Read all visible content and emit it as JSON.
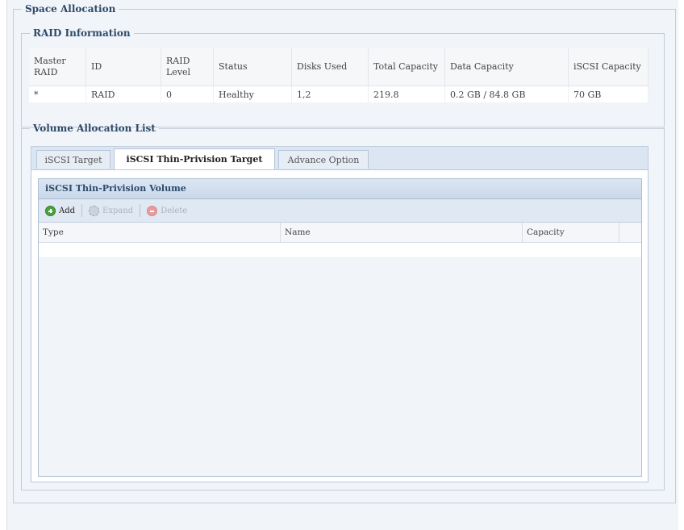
{
  "space_allocation": {
    "title": "Space Allocation"
  },
  "raid_info": {
    "title": "RAID Information",
    "headers": [
      "Master RAID",
      "ID",
      "RAID Level",
      "Status",
      "Disks Used",
      "Total Capacity",
      "Data Capacity",
      "iSCSI Capacity"
    ],
    "rows": [
      [
        "*",
        "RAID",
        "0",
        "Healthy",
        "1,2",
        "219.8",
        "0.2 GB / 84.8 GB",
        "70 GB"
      ]
    ]
  },
  "volume_list": {
    "title": "Volume Allocation List",
    "tabs": [
      {
        "label": "iSCSI Target",
        "active": false
      },
      {
        "label": "iSCSI Thin-Privision Target",
        "active": true
      },
      {
        "label": "Advance Option",
        "active": false
      }
    ],
    "panel_title": "iSCSI Thin-Privision Volume",
    "toolbar": {
      "add_label": "Add",
      "expand_label": "Expand",
      "delete_label": "Delete"
    },
    "grid_headers": [
      "Type",
      "Name",
      "Capacity"
    ]
  }
}
